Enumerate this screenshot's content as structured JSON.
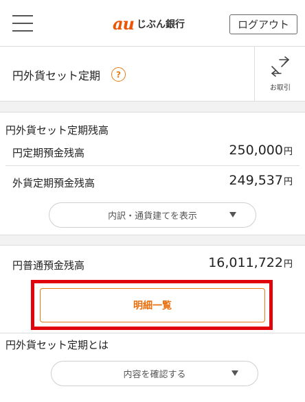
{
  "header": {
    "logo_brand": "au",
    "logo_bank": "じぶん銀行",
    "logout_label": "ログアウト"
  },
  "product": {
    "title": "円外貨セット定期",
    "help_icon": "?",
    "trade_label": "お取引"
  },
  "balance": {
    "section_title": "円外貨セット定期残高",
    "yen_time_deposit_label": "円定期預金残高",
    "yen_time_deposit_amount": "250,000",
    "foreign_time_deposit_label": "外貨定期預金残高",
    "foreign_time_deposit_amount": "249,537",
    "currency_unit": "円",
    "breakdown_button": "内訳・通貨建てを表示"
  },
  "ordinary": {
    "label": "円普通預金残高",
    "amount": "16,011,722",
    "currency_unit": "円",
    "detail_button": "明細一覧"
  },
  "about": {
    "title": "円外貨セット定期とは",
    "confirm_button": "内容を確認する"
  },
  "colors": {
    "accent": "#eb7a14",
    "highlight_frame": "#e0040c",
    "brand": "#eb5505"
  },
  "icons": {
    "menu": "hamburger-menu-icon",
    "help": "question-circle-icon",
    "trade": "swap-arrows-icon",
    "dropdown": "triangle-down-icon"
  }
}
